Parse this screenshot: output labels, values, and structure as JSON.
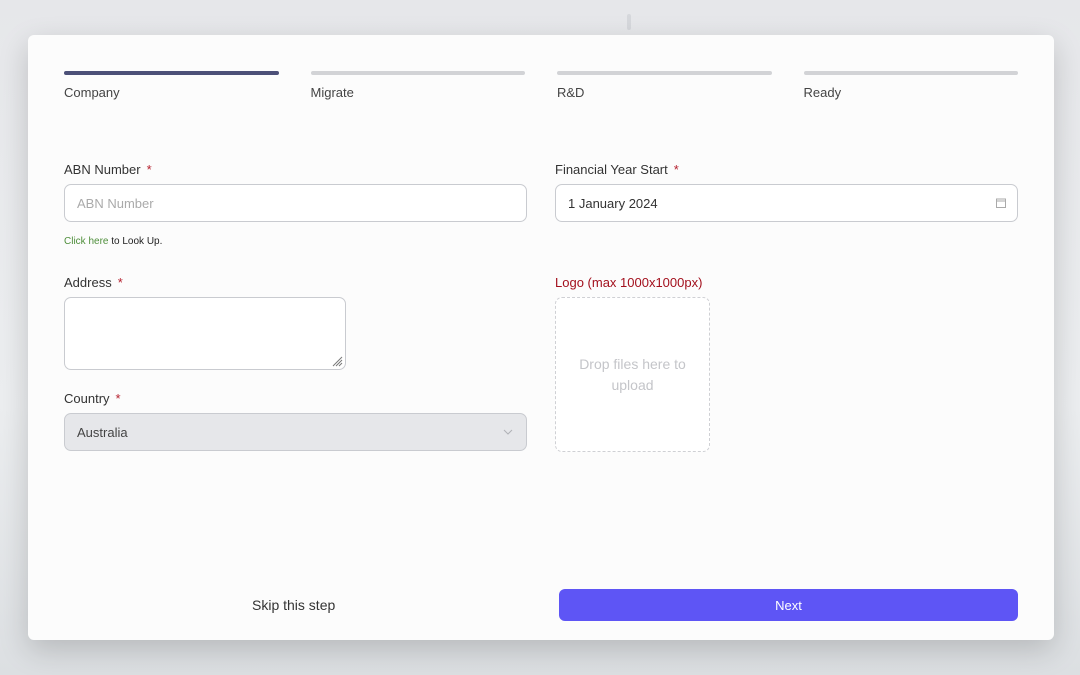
{
  "wizard": {
    "steps": [
      {
        "label": "Company",
        "state": "active"
      },
      {
        "label": "Migrate",
        "state": "pending"
      },
      {
        "label": "R&D",
        "state": "pending"
      },
      {
        "label": "Ready",
        "state": "pending"
      }
    ]
  },
  "form": {
    "abn": {
      "label": "ABN Number",
      "required_mark": "*",
      "value": "",
      "placeholder": "ABN Number",
      "hint_link": "Click here",
      "hint_text": " to Look Up."
    },
    "financial_year": {
      "label": "Financial Year Start",
      "required_mark": "*",
      "value": "1 January 2024",
      "icon": "calendar-icon"
    },
    "address": {
      "label": "Address",
      "required_mark": "*",
      "value": ""
    },
    "logo": {
      "label": "Logo (max 1000x1000px)",
      "dropzone_text": "Drop files here to upload"
    },
    "country": {
      "label": "Country",
      "required_mark": "*",
      "selected": "Australia",
      "icon": "chevron-down-icon"
    }
  },
  "actions": {
    "skip_label": "Skip this step",
    "next_label": "Next"
  },
  "colors": {
    "active_step": "#4c5078",
    "inactive_step": "#d2d3d6",
    "primary_button": "#5e55f5",
    "required": "#b5202e",
    "link": "#4e8e3a",
    "logo_label": "#a3101d"
  }
}
